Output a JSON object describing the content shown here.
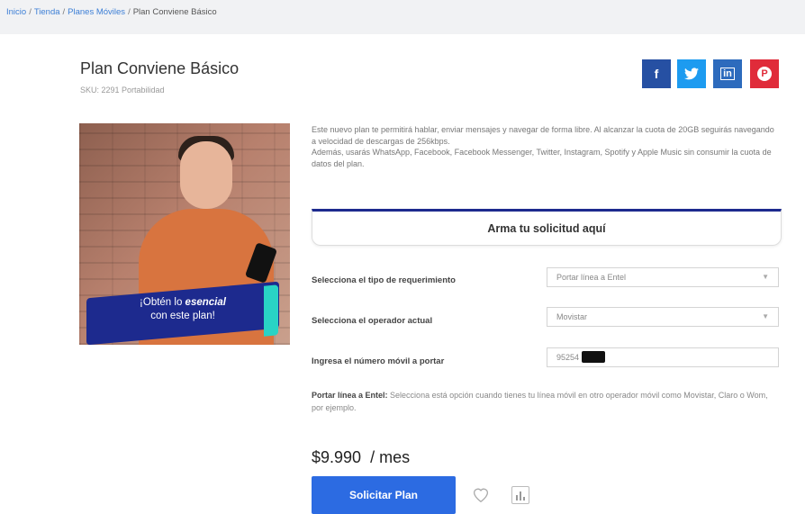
{
  "breadcrumb": {
    "items": [
      "Inicio",
      "Tienda",
      "Planes Móviles"
    ],
    "current": "Plan Conviene Básico",
    "separator": "/"
  },
  "product": {
    "title": "Plan Conviene Básico",
    "sku": "SKU: 2291 Portabilidad"
  },
  "share": {
    "facebook": {
      "label": "f",
      "color": "#2650a3"
    },
    "twitter": {
      "label": "t",
      "color": "#1d9bf0"
    },
    "linkedin": {
      "label": "in",
      "color": "#2d6bbd"
    },
    "pinterest": {
      "label": "P",
      "color": "#e02b3a"
    }
  },
  "hero": {
    "badge_line1_prefix": "¡Obtén lo ",
    "badge_line1_emphasis": "esencial",
    "badge_line2": "con este plan!"
  },
  "description": {
    "p1": "Este nuevo plan te permitirá hablar, enviar mensajes y navegar de forma libre. Al alcanzar la cuota de 20GB seguirás navegando a velocidad de descargas de 256kbps.",
    "p2": "Además, usarás WhatsApp, Facebook, Facebook Messenger, Twitter, Instagram, Spotify y Apple Music sin consumir la cuota de datos del plan."
  },
  "form": {
    "heading": "Arma tu solicitud aquí",
    "requirement": {
      "label": "Selecciona el tipo de requerimiento",
      "value": "Portar línea a Entel"
    },
    "operator": {
      "label": "Selecciona el operador actual",
      "value": "Movistar"
    },
    "number": {
      "label": "Ingresa el número móvil a portar",
      "value": "95254"
    }
  },
  "note": {
    "title": "Portar línea a Entel:",
    "text": "Selecciona está opción cuando tienes tu línea móvil en otro operador móvil como Movistar, Claro o Wom, por ejemplo."
  },
  "price": {
    "amount": "$9.990",
    "period": "/ mes"
  },
  "cta": {
    "label": "Solicitar Plan"
  },
  "icons": {
    "wishlist": "heart-icon",
    "compare": "bar-chart-icon"
  }
}
